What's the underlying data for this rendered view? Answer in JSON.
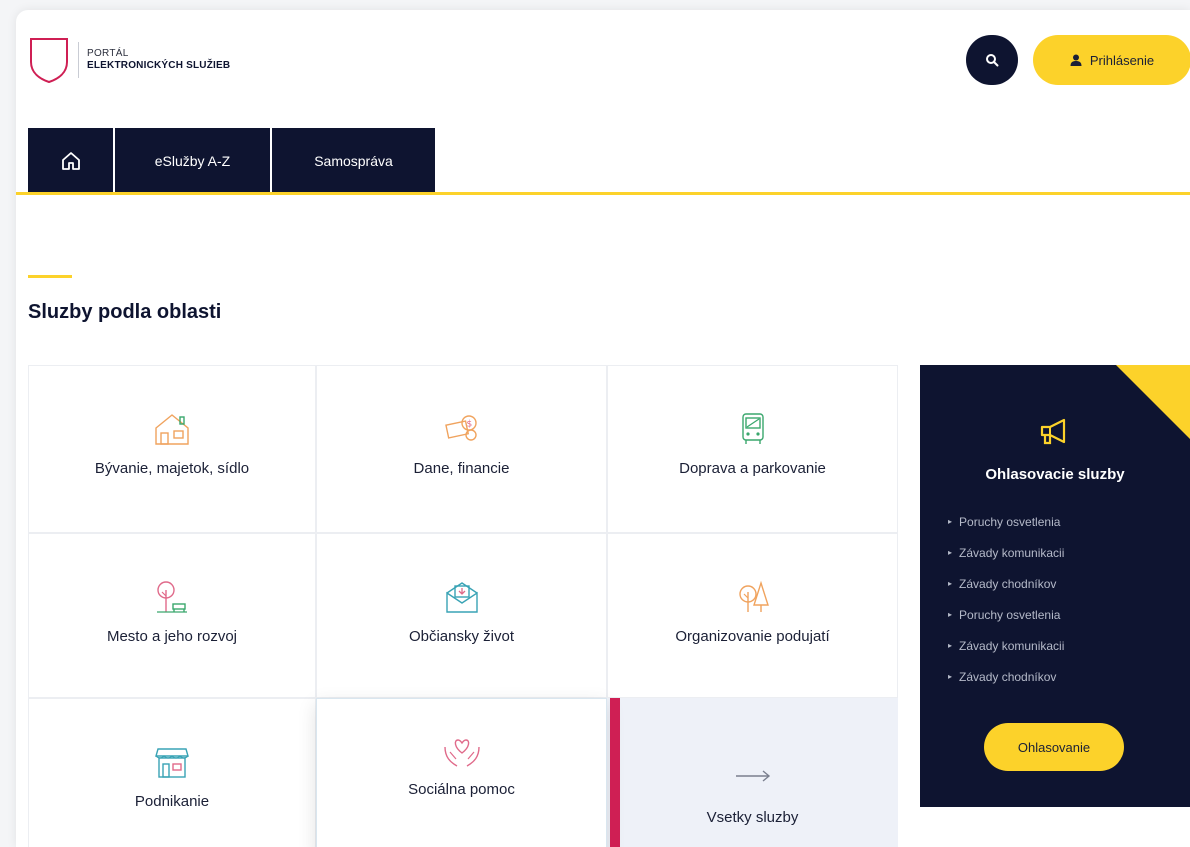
{
  "header": {
    "logo_line1": "PORTÁL",
    "logo_line2": "ELEKTRONICKÝCH SLUŽIEB",
    "login_label": "Prihlásenie"
  },
  "nav": {
    "items": [
      {
        "label": "",
        "icon": "home-icon"
      },
      {
        "label": "eSlužby A-Z"
      },
      {
        "label": "Samospráva"
      }
    ]
  },
  "section": {
    "title": "Sluzby podla oblasti"
  },
  "categories": [
    {
      "label": "Bývanie, majetok, sídlo",
      "icon": "house-icon"
    },
    {
      "label": "Dane, financie",
      "icon": "money-icon"
    },
    {
      "label": "Doprava a parkovanie",
      "icon": "bus-icon"
    },
    {
      "label": "Mesto a jeho rozvoj",
      "icon": "tree-bench-icon"
    },
    {
      "label": "Občiansky život",
      "icon": "mail-icon"
    },
    {
      "label": "Organizovanie podujatí",
      "icon": "trees-icon"
    },
    {
      "label": "Podnikanie",
      "icon": "shop-icon"
    },
    {
      "label": "Sociálna pomoc",
      "icon": "heart-hands-icon"
    },
    {
      "label": "Vsetky sluzby",
      "icon": "arrow-right-icon"
    }
  ],
  "panel": {
    "title": "Ohlasovacie sluzby",
    "icon": "megaphone-icon",
    "items": [
      "Poruchy osvetlenia",
      "Závady komunikacii",
      "Závady chodníkov",
      "Poruchy osvetlenia",
      "Závady komunikacii",
      "Závady chodníkov"
    ],
    "button_label": "Ohlasovanie"
  },
  "colors": {
    "navy": "#0e1430",
    "yellow": "#fcd22a",
    "accent_red": "#cf1f54",
    "icon_orange": "#f0a35e",
    "icon_green": "#3aa76d",
    "icon_pink": "#e06a8a",
    "icon_teal": "#39a3b5"
  }
}
